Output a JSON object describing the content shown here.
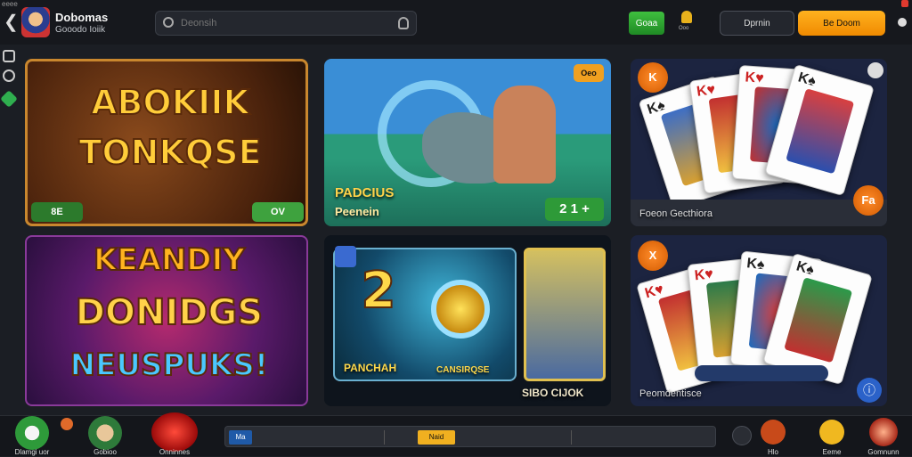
{
  "header": {
    "brand_title": "Dobomas",
    "brand_subtitle": "Gooodo Ioiik",
    "search_placeholder": "Deonsih",
    "btn_green": "Goaa",
    "bell_label": "Ooo",
    "btn_dark": "Dprnin",
    "btn_orange": "Be Doom"
  },
  "tiles": [
    {
      "title_line1": "ABOKIIK",
      "title_line2": "TONKQSE",
      "pill_left": "8E",
      "pill_right": "OV"
    },
    {
      "title_line1": "PADCIUS",
      "title_line2": "Peenein",
      "corner_badge": "Oeo",
      "pill_right": "2 1 +"
    },
    {
      "badge": "K",
      "caption": "Foeon Gecthiora",
      "corner_btn": "Fa"
    },
    {
      "title_line1": "KEANDIY",
      "title_line2": "DONIDGS",
      "title_line3": "NEUSPUKS!"
    },
    {
      "big_number": "2",
      "label_left": "PANCHAH",
      "label_right": "CANSIRQSE",
      "card_title": "SIBO CIJOK"
    },
    {
      "badge": "X",
      "caption": "Peomdentisce"
    }
  ],
  "bottom": {
    "nav_left": [
      "Dlamgi uor",
      "Gobioo",
      "Onninnes"
    ],
    "nav_right": [
      "Hlo",
      "Eeme",
      "Gomnunn"
    ],
    "progress_chip_1": "Ma",
    "progress_chip_2": "Naid",
    "progress_value_pct": 38
  }
}
